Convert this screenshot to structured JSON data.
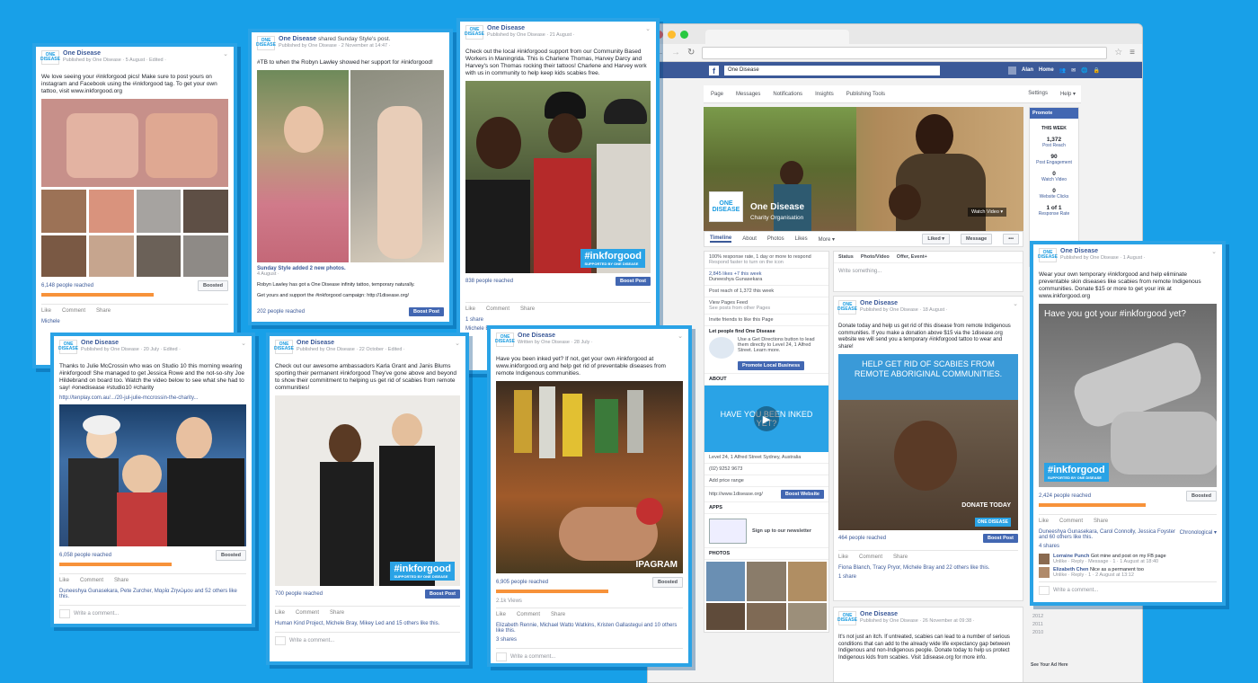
{
  "colors": {
    "background": "#18a0e8",
    "accent": "#2aa3e6",
    "fb_blue": "#3b5998",
    "reach_bar": "#f7923a"
  },
  "browser": {
    "search": "One Disease",
    "user": "Alan",
    "home": "Home",
    "page_nav": [
      "Page",
      "Messages",
      "Notifications",
      "Insights",
      "Publishing Tools"
    ],
    "page_nav_right": [
      "Settings",
      "Help ▾"
    ],
    "page_name": "One Disease",
    "page_category": "Charity Organisation",
    "watch_video": "Watch Video ▾",
    "profile_tabs": [
      "Timeline",
      "About",
      "Photos",
      "Likes",
      "More ▾"
    ],
    "liked_btn": "Liked ▾",
    "message_btn": "Message",
    "promote": "Promote",
    "this_week": "THIS WEEK",
    "stats": [
      {
        "n": "1,372",
        "l": "Post Reach"
      },
      {
        "n": "90",
        "l": "Post Engagement"
      },
      {
        "n": "0",
        "l": "Watch Video"
      },
      {
        "n": "0",
        "l": "Website Clicks"
      },
      {
        "n": "1 of 1",
        "l": "Response Rate"
      }
    ],
    "sidebar": [
      "100% response rate, 1 day or more to respond",
      "Respond faster to turn on the icon",
      "2,845 likes +7 this week",
      "Duneeshya Gunasekara",
      "Post reach of 1,372 this week",
      "View Pages Feed",
      "See posts from other Pages",
      "Invite friends to like this Page",
      "Let people find One Disease",
      "Use a Get Directions button to lead them directly to Level 24, 1 Alfred Street. Learn more.",
      "Promote Local Business",
      "ABOUT",
      "HAVE YOU BEEN INKED YET?",
      "Level 24, 1 Alfred Street Sydney, Australia",
      "(02) 9252 9673",
      "Add price range",
      "http://www.1disease.org/",
      "Boost Website",
      "APPS",
      "Sign up to our newsletter",
      "PHOTOS"
    ],
    "composer": [
      "Status",
      "Photo/Video",
      "Offer, Event+"
    ],
    "write_something": "Write something...",
    "post_a": {
      "name": "One Disease",
      "meta": "Published by One Disease · 18 August ·",
      "text": "Donate today and help us get rid of this disease from remote Indigenous communities. If you make a donation above $15 via the 1disease.org website we will send you a temporary #inkforgood tattoo to wear and share!",
      "img_text": "HELP GET RID OF SCABIES FROM REMOTE ABORIGINAL COMMUNITIES.",
      "img_corner": "DONATE TODAY",
      "reach": "464 people reached",
      "boost": "Boost Post",
      "acts": [
        "Like",
        "Comment",
        "Share"
      ],
      "likes": "Fiona Blanch, Tracy Pryor, Michele Bray and 22 others like this.",
      "shares": "1 share"
    },
    "post_b": {
      "name": "One Disease",
      "meta": "Published by One Disease · 26 November at 09:38 ·",
      "text": "It's not just an itch. If untreated, scabies can lead to a number of serious conditions that can add to the already wide life expectancy gap between Indigenous and non-Indigenous people. Donate today to help us protect Indigenous kids from scabies. Visit 1disease.org for more info."
    },
    "years": [
      "2012",
      "2011",
      "2010"
    ],
    "see_ad": "See Your Ad Here"
  },
  "cards": [
    {
      "name": "One Disease",
      "meta": "Published by One Disease · 5 August · Edited ·",
      "text": "We love seeing your #inkforgood pics! Make sure to post yours on instagram and Facebook using the #inkforgood tag. To get your own tattoo, visit www.inkforgood.org",
      "reach": "6,148 people reached",
      "btn": "Boosted",
      "acts": [
        "Like",
        "Comment",
        "Share"
      ],
      "bottom": "Michele"
    },
    {
      "name": "One Disease",
      "meta": "Published by One Disease · 2 November at 14:47 ·",
      "shared": "shared Sunday Style's post.",
      "text": "#TB to when the Robyn Lawley showed her support for #inkforgood!",
      "sub_name": "Sunday Style added 2 new photos.",
      "sub_date": "4 August ·",
      "sub_text": "Robyn Lawley has got a One Disease infinity tattoo, temporary naturally.",
      "sub_text2": "Get yours and support the #inkforgood campaign: http://1disease.org/",
      "reach": "202 people reached",
      "btn": "Boost Post"
    },
    {
      "name": "One Disease",
      "meta": "Published by One Disease · 21 August ·",
      "text": "Check out the local #inkforgood support from our Community Based Workers in Maningrida. This is Charlene Thomas, Harvey Darcy and Harvey's son Thomas rocking their tattoos! Charlene and Harvey work with us in community to help keep kids scabies free.",
      "tag": "#inkforgood",
      "tag_sub": "SUPPORTED BY ONE DISEASE",
      "reach": "838 people reached",
      "btn": "Boost Post",
      "acts": [
        "Like",
        "Comment",
        "Share"
      ],
      "shares": "1 share",
      "bottom": "Michele Bray"
    },
    {
      "name": "One Disease",
      "meta": "Published by One Disease · 20 July · Edited ·",
      "text": "Thanks to Julie McCrossin who was on Studio 10 this morning wearing #inkforgood! She managed to get Jessica Rowe and the not-so-shy Joe Hildebrand on board too. Watch the video below to see what she had to say! #onedisease #studio10 #charity",
      "link": "http://tenplay.com.au/.../20-jul-julie-mccrossin-the-charity...",
      "reach": "6,058 people reached",
      "btn": "Boosted",
      "acts": [
        "Like",
        "Comment",
        "Share"
      ],
      "likes": "Duneeshya Gunasekara, Pete Zurcher, Μαρία Ζηνώμου and 52 others like this.",
      "comment": "Write a comment..."
    },
    {
      "name": "One Disease",
      "meta": "Published by One Disease · 22 October · Edited ·",
      "text": "Check out our awesome ambassadors Karla Grant and Janis Blums sporting their permanent #inkforgood They've gone above and beyond to show their commitment to helping us get rid of scabies from remote communities!",
      "tag": "#inkforgood",
      "tag_sub": "SUPPORTED BY ONE DISEASE",
      "reach": "700 people reached",
      "btn": "Boost Post",
      "acts": [
        "Like",
        "Comment",
        "Share"
      ],
      "likes": "Human Kind Project, Michele Bray, Mikey Led and 15 others like this.",
      "comment": "Write a comment..."
    },
    {
      "name": "One Disease",
      "meta": "Written by One Disease · 28 July ·",
      "text": "Have you been inked yet? If not, get your own #inkforgood at www.inkforgood.org and help get rid of preventable diseases from remote Indigenous communities.",
      "watermark": "IPAGRAM",
      "reach": "6,905 people reached",
      "btn": "Boosted",
      "views": "2.1k Views",
      "acts": [
        "Like",
        "Comment",
        "Share"
      ],
      "likes": "Elizabeth Rennie, Michael Watto Watkins, Kristen Gallastegui and 10 others like this.",
      "shares": "3 shares",
      "comment": "Write a comment..."
    },
    {
      "name": "One Disease",
      "meta": "Published by One Disease · 1 August ·",
      "text": "Wear your own temporary #inkforgood and help eliminate preventable skin diseases like scabies from remote Indigenous communities. Donate $15 or more to get your ink at www.inkforgood.org",
      "img_text": "Have you got your #inkforgood yet?",
      "tag": "#inkforgood",
      "tag_sub": "SUPPORTED BY ONE DISEASE",
      "reach": "2,424 people reached",
      "btn": "Boosted",
      "acts": [
        "Like",
        "Comment",
        "Share"
      ],
      "likes": "Duneeshya Gunasekara, Carol Connolly, Jessica Foyster and 60 others like this.",
      "sort": "Chronological ▾",
      "shares": "4 shares",
      "c1_name": "Lorraine Punch",
      "c1_text": "Got mine and post on my FB page",
      "c1_meta": "Unlike · Reply · Message · 1 · 1 August at 18:40",
      "c2_name": "Elizabeth Chen",
      "c2_text": "Nice as a permanent too",
      "c2_meta": "Unlike · Reply · 1 · 2 August at 13:12",
      "comment": "Write a comment..."
    }
  ]
}
